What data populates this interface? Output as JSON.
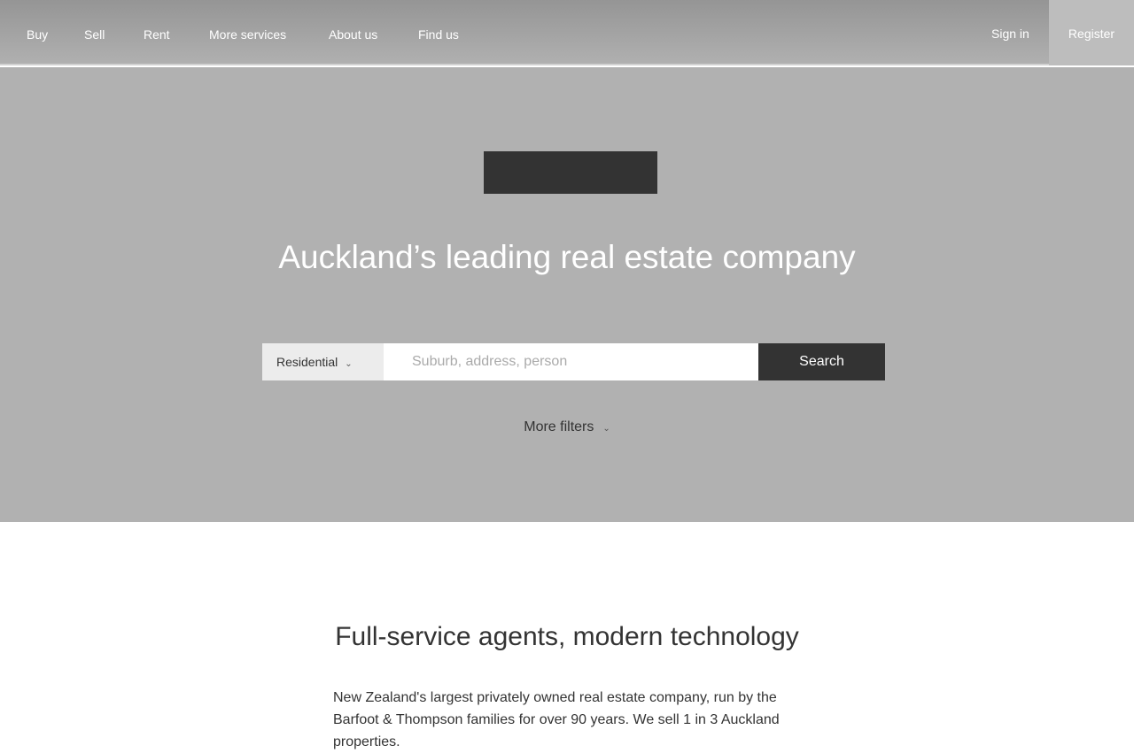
{
  "nav": {
    "items": [
      "Buy",
      "Sell",
      "Rent",
      "More services",
      "About us",
      "Find us"
    ],
    "sign_in": "Sign in",
    "register": "Register"
  },
  "hero": {
    "title": "Auckland’s leading real estate company",
    "type_select": "Residential",
    "search_placeholder": "Suburb, address, person",
    "search_value": "",
    "search_button": "Search",
    "more_filters": "More filters"
  },
  "intro": {
    "heading": "Full-service agents, modern technology",
    "body": "New Zealand's largest privately owned real estate company, run by the Barfoot & Thompson families for over 90 years. We sell 1 in 3 Auckland properties."
  }
}
